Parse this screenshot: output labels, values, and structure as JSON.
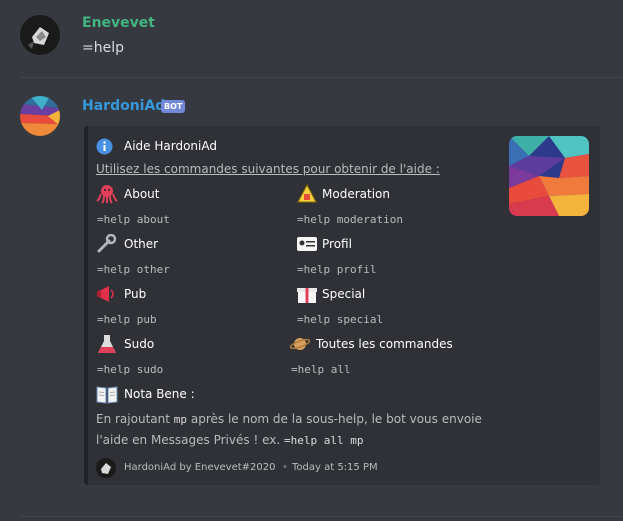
{
  "message1": {
    "username": "Enevevet",
    "text": "=help",
    "username_color": "#43b581"
  },
  "message2": {
    "username": "HardoniAd",
    "bot_tag": "BOT",
    "username_color": "#3498db"
  },
  "embed": {
    "author_icon": "info-icon",
    "author": "Aide HardoniAd",
    "description": "Utilisez les commandes suivantes pour obtenir de l'aide :",
    "fields": [
      {
        "icon": "octopus-icon",
        "name": "About",
        "value": "=help about"
      },
      {
        "icon": "moderation-icon",
        "name": "Moderation",
        "value": "=help moderation"
      },
      {
        "icon": "wrench-icon",
        "name": "Other",
        "value": "=help other"
      },
      {
        "icon": "id-card-icon",
        "name": "Profil",
        "value": "=help profil"
      },
      {
        "icon": "megaphone-icon",
        "name": "Pub",
        "value": "=help pub"
      },
      {
        "icon": "gift-icon",
        "name": "Special",
        "value": "=help special"
      },
      {
        "icon": "flask-icon",
        "name": "Sudo",
        "value": "=help sudo"
      },
      {
        "icon": "planet-icon",
        "name": "Toutes les commandes",
        "value": "=help all"
      }
    ],
    "nota": {
      "icon": "book-icon",
      "name": "Nota Bene :",
      "text_1": "En rajoutant",
      "code_1": "mp",
      "text_2": "après le nom de la sous-help, le bot vous envoie l'aide en Messages Privés ! ex.",
      "code_2": "=help all mp"
    },
    "footer": {
      "text": "HardoniAd by Enevevet#2020",
      "separator": "•",
      "timestamp": "Today at 5:15 PM"
    }
  },
  "colors": {
    "background": "#36393f",
    "embed_background": "#2f3136",
    "bot_tag": "#7289da"
  }
}
